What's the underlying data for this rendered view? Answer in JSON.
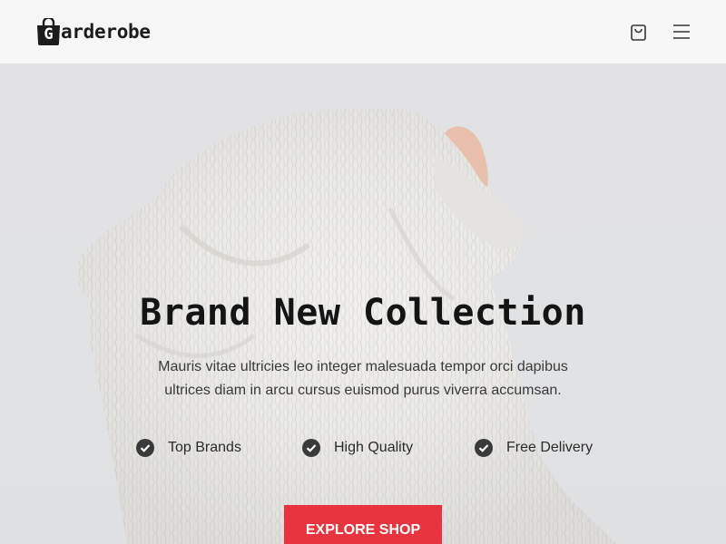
{
  "brand": {
    "logo_letter": "G",
    "name": "arderobe"
  },
  "header": {
    "cart_icon": "shopping-bag-icon",
    "menu_icon": "hamburger-menu-icon"
  },
  "hero": {
    "title": "Brand New Collection",
    "subtitle": "Mauris vitae ultricies leo integer malesuada tempor orci dapibus ultrices diam in arcu cursus euismod purus viverra accumsan.",
    "features": [
      {
        "label": "Top Brands",
        "icon": "check-circle-icon"
      },
      {
        "label": "High Quality",
        "icon": "check-circle-icon"
      },
      {
        "label": "Free Delivery",
        "icon": "check-circle-icon"
      }
    ],
    "cta_label": "EXPLORE SHOP"
  },
  "colors": {
    "accent": "#e8343f",
    "navbar_bg": "#f7f7f7",
    "hero_bg": "#dcdcde",
    "text_dark": "#141414"
  }
}
